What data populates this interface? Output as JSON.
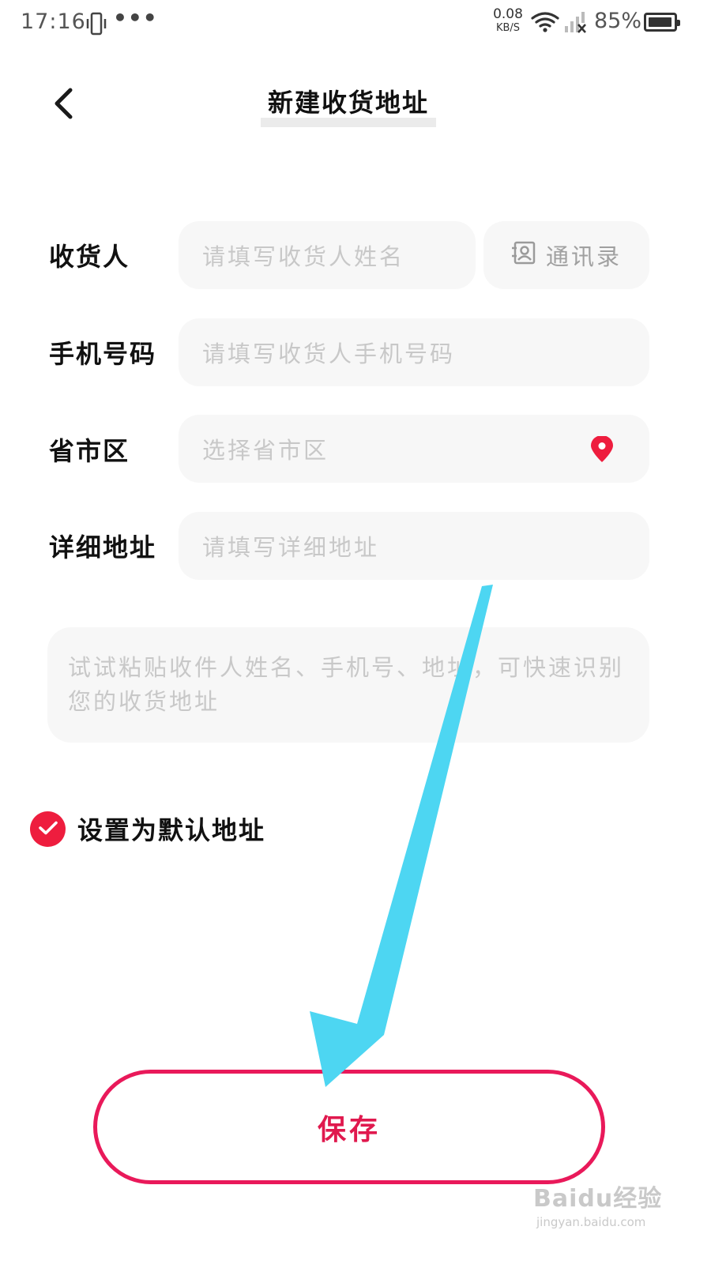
{
  "status_bar": {
    "time": "17:16",
    "more": "•••",
    "net_speed_value": "0.08",
    "net_speed_unit": "KB/S",
    "battery": "85%"
  },
  "header": {
    "title": "新建收货地址",
    "back_icon": "chevron-left-icon"
  },
  "form": {
    "recipient": {
      "label": "收货人",
      "placeholder": "请填写收货人姓名",
      "contacts_label": "通讯录",
      "contacts_icon": "contact-book-icon"
    },
    "phone": {
      "label": "手机号码",
      "placeholder": "请填写收货人手机号码"
    },
    "region": {
      "label": "省市区",
      "placeholder": "选择省市区",
      "icon": "location-pin-icon"
    },
    "address": {
      "label": "详细地址",
      "placeholder": "请填写详细地址"
    },
    "paste_hint": "试试粘贴收件人姓名、手机号、地址，可快速识别您的收货地址"
  },
  "default_address": {
    "label": "设置为默认地址",
    "checked": true
  },
  "save": {
    "label": "保存"
  },
  "watermark": {
    "brand": "Baidu经验",
    "url": "jingyan.baidu.com"
  },
  "colors": {
    "accent_red": "#ee1d3e",
    "save_border": "#e9195a",
    "arrow": "#4dd6f2",
    "field_bg": "#f7f7f7",
    "placeholder": "#c8c8c8"
  }
}
